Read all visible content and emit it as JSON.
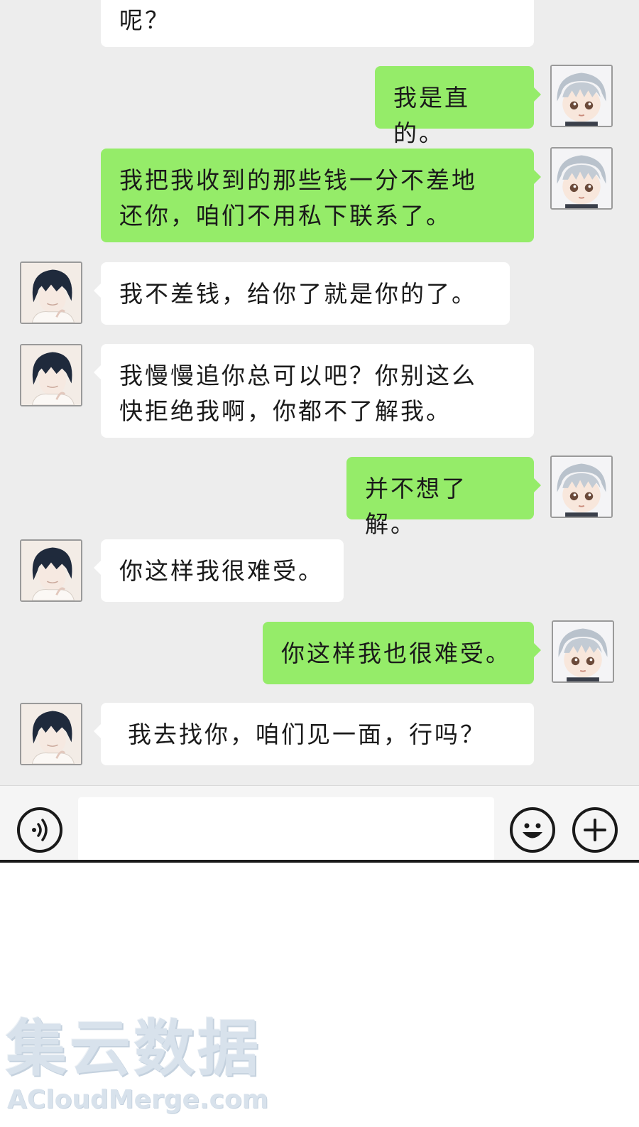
{
  "messages": [
    {
      "side": "in",
      "text": "呢？"
    },
    {
      "side": "out",
      "text": "我是直的。"
    },
    {
      "side": "out",
      "text": "我把我收到的那些钱一分不差地\n还你，咱们不用私下联系了。"
    },
    {
      "side": "in",
      "text": "我不差钱，给你了就是你的了。"
    },
    {
      "side": "in",
      "text": "我慢慢追你总可以吧？你别这么\n快拒绝我啊，你都不了解我。"
    },
    {
      "side": "out",
      "text": "并不想了解。"
    },
    {
      "side": "in",
      "text": "你这样我很难受。"
    },
    {
      "side": "out",
      "text": "你这样我也很难受。"
    },
    {
      "side": "in",
      "text": "我去找你，咱们见一面，行吗？"
    }
  ],
  "input_bar": {
    "voice_icon": "voice-icon",
    "emoji_icon": "emoji-icon",
    "plus_icon": "plus-icon",
    "input_value": ""
  },
  "watermark": {
    "chinese": "集云数据",
    "english": "ACloudMerge.com"
  },
  "colors": {
    "chat_background": "#ededed",
    "outgoing_bubble": "#95ec69",
    "incoming_bubble": "#ffffff"
  }
}
